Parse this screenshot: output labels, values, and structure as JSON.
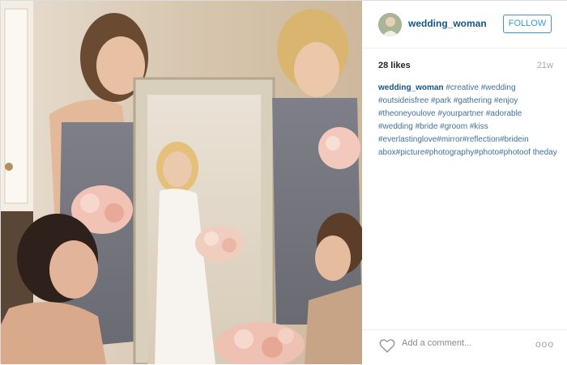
{
  "header": {
    "username": "wedding_woman",
    "follow_label": "FOLLOW"
  },
  "stats": {
    "likes": "28 likes",
    "time_ago": "21w"
  },
  "caption": {
    "username": "wedding_woman",
    "text": "#creative #wedding #outsideisfree #park #gathering #enjoy #theoneyoulove #yourpartner #adorable #wedding #bride #groom #kiss #everlastinglove#mirror#reflection#bridein abox#picture#photography#photo#photoof theday"
  },
  "footer": {
    "comment_placeholder": "Add a comment...",
    "more_glyph": "ooo"
  },
  "icons": {
    "like": "heart-icon",
    "more": "more-options-icon"
  },
  "colors": {
    "username": "#125688",
    "hashtag": "#3f729b",
    "follow_border": "#4090db",
    "follow_text": "#3897f0"
  }
}
